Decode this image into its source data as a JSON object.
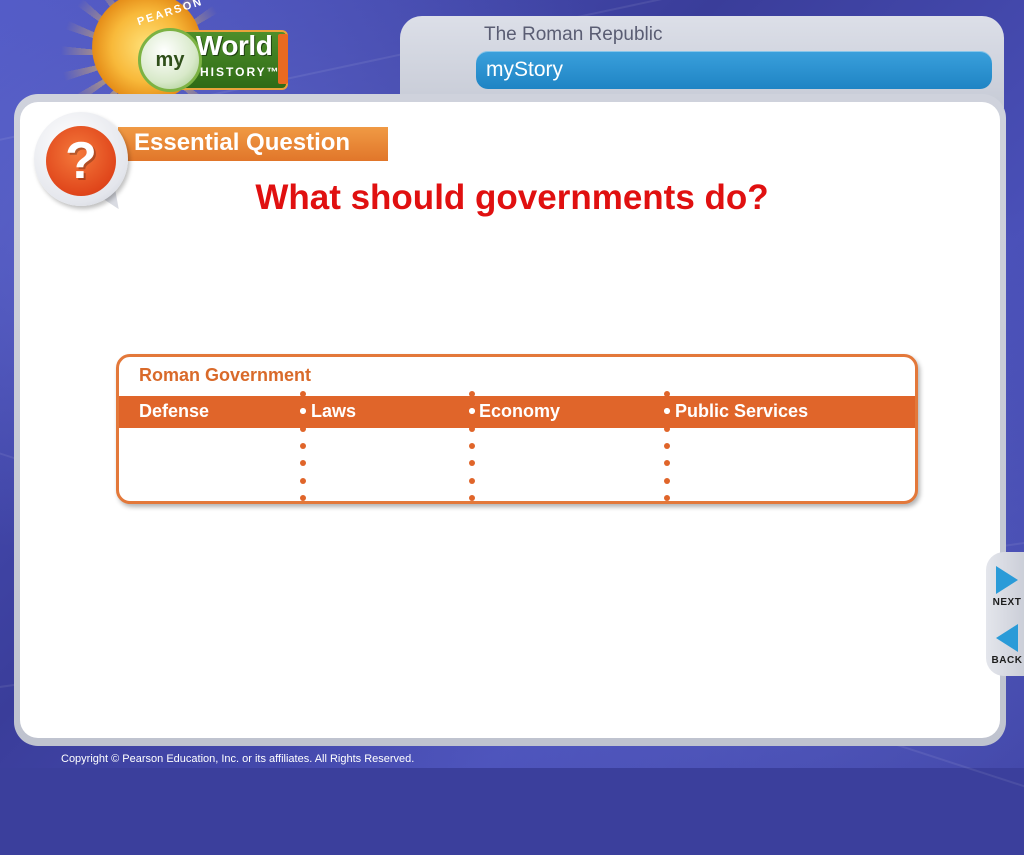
{
  "logo": {
    "publisher": "PEARSON",
    "my": "my",
    "world": "World",
    "history": "HISTORY™"
  },
  "header": {
    "title": "The Roman Republic",
    "section": "myStory"
  },
  "essential_question": {
    "label": "Essential Question",
    "icon": "question-mark-icon",
    "question": "What should governments do?"
  },
  "organizer": {
    "title": "Roman Government",
    "columns": [
      "Defense",
      "Laws",
      "Economy",
      "Public Services"
    ]
  },
  "nav": {
    "next": "NEXT",
    "back": "BACK"
  },
  "footer": {
    "copyright": "Copyright © Pearson Education, Inc. or its affiliates. All Rights Reserved."
  },
  "colors": {
    "question": "#e01010",
    "orange": "#e0652a",
    "header_bar": "#2a94d4",
    "nav_arrow": "#2a9bd8"
  }
}
